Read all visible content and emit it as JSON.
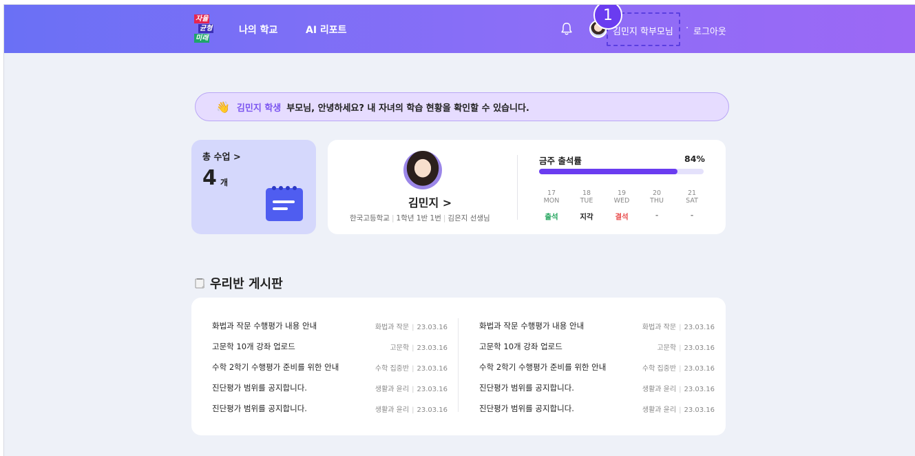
{
  "header": {
    "logo_lines": [
      "자율",
      "균형",
      "미래"
    ],
    "nav": [
      "나의 학교",
      "AI 리포트"
    ],
    "user_name": "김민지 학부모님",
    "separator": "·",
    "logout": "로그아웃",
    "callout_number": "1"
  },
  "greeting": {
    "student": "김민지 학생",
    "message": "부모님, 안녕하세요? 내 자녀의 학습  현황을 확인할 수 있습니다."
  },
  "lessons": {
    "label": "총 수업 >",
    "count": "4",
    "unit": "개"
  },
  "profile": {
    "name": "김민지 >",
    "school": "한국고등학교",
    "class": "1학년 1반 1번",
    "teacher": "김은지 선생님",
    "divider": "|"
  },
  "attendance": {
    "title": "금주 출석률",
    "percent_label": "84%",
    "percent": 84,
    "days": [
      {
        "date": "17",
        "dow": "MON",
        "status": "출석",
        "color": "#1fa35a"
      },
      {
        "date": "18",
        "dow": "TUE",
        "status": "지각",
        "color": "#222222"
      },
      {
        "date": "19",
        "dow": "WED",
        "status": "결석",
        "color": "#e84a4a"
      },
      {
        "date": "20",
        "dow": "THU",
        "status": "-",
        "color": "#888888"
      },
      {
        "date": "21",
        "dow": "SAT",
        "status": "-",
        "color": "#888888"
      }
    ]
  },
  "board": {
    "title": "우리반 게시판",
    "divider": "|",
    "left": [
      {
        "title": "화법과 작문 수행평가 내용 안내",
        "subject": "화법과 작문",
        "date": "23.03.16"
      },
      {
        "title": "고문학 10개 강좌 업로드",
        "subject": "고문학",
        "date": "23.03.16"
      },
      {
        "title": "수학 2학기 수행평가 준비를 위한 안내",
        "subject": "수학 집중반",
        "date": "23.03.16"
      },
      {
        "title": "진단평가 범위를 공지합니다.",
        "subject": "생활과 윤리",
        "date": "23.03.16"
      },
      {
        "title": "진단평가 범위를 공지합니다.",
        "subject": "생활과 윤리",
        "date": "23.03.16"
      }
    ],
    "right": [
      {
        "title": "화법과 작문 수행평가 내용 안내",
        "subject": "화법과 작문",
        "date": "23.03.16"
      },
      {
        "title": "고문학 10개 강좌 업로드",
        "subject": "고문학",
        "date": "23.03.16"
      },
      {
        "title": "수학 2학기 수행평가 준비를 위한 안내",
        "subject": "수학 집중반",
        "date": "23.03.16"
      },
      {
        "title": "진단평가 범위를 공지합니다.",
        "subject": "생활과 윤리",
        "date": "23.03.16"
      },
      {
        "title": "진단평가 범위를 공지합니다.",
        "subject": "생활과 윤리",
        "date": "23.03.16"
      }
    ]
  },
  "colors": {
    "accent": "#6a3cf0",
    "header_start": "#6a70f5",
    "header_end": "#9c68f5",
    "background": "#eef1f8"
  }
}
